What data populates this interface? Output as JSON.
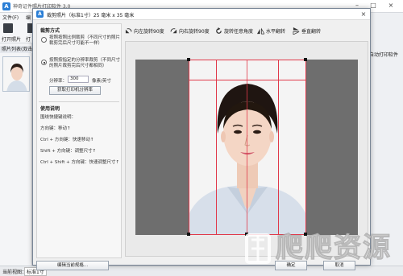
{
  "main_window": {
    "title": "神奇证件照片打印软件 3.0",
    "menu": [
      "文件(F)",
      "编"
    ],
    "toolbar": [
      "打开照片",
      "打"
    ],
    "list_header": "照片列表(双击",
    "right_side_label": "自动打印软件",
    "status_label": "当前视图：",
    "status_value": "标准1寸"
  },
  "dialog": {
    "title": "裁剪照片（标准1寸）25 毫米 x 35 毫米",
    "close_glyph": "×",
    "crop_mode": {
      "group_title": "裁剪方式",
      "option_ratio": "按照按照比例裁剪（不同尺寸的照片裁剪完后尺寸可能不一样）",
      "option_dpi": "按照按指定的分辨率裁剪（不同尺寸的照片裁剪完后尺寸都相同）",
      "selected": "dpi",
      "dpi_label": "分辨率：",
      "dpi_value": "300",
      "dpi_unit": "像素/英寸",
      "get_dpi_button": "获取打印机分辨率"
    },
    "help": {
      "title": "使用说明",
      "lines": [
        "围绕快捷键说明：",
        "方向键：移动↑",
        "Ctrl + 方向键：快速移动↑",
        "Shift + 方向键：调整尺寸↑",
        "Ctrl + Shift + 方向键：快速调整尺寸↑"
      ]
    },
    "toolbar": {
      "rotate_left": "向左旋转90度",
      "rotate_right": "向右旋转90度",
      "rotate_any": "旋转任意角度",
      "flip_horizontal": "水平翻转",
      "flip_vertical": "垂直翻转"
    },
    "buttons": {
      "edit_template": "编辑当前规格...",
      "ok": "确定",
      "cancel": "取消"
    }
  },
  "watermark_text": "爬爬资源",
  "colors": {
    "accent": "#2b7fd6",
    "crop_line": "#e0394a",
    "photo_background": "#f4f4f4",
    "canvas_gray": "#6e6e6e"
  }
}
